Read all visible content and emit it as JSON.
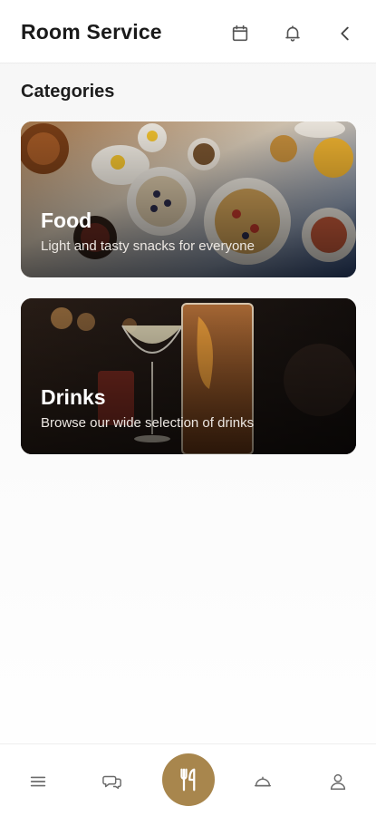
{
  "header": {
    "title": "Room Service",
    "icons": [
      "calendar-icon",
      "bell-icon",
      "back-chevron-icon"
    ]
  },
  "section": {
    "title": "Categories"
  },
  "categories": [
    {
      "title": "Food",
      "subtitle": "Light and tasty snacks for everyone"
    },
    {
      "title": "Drinks",
      "subtitle": "Browse our wide selection of drinks"
    }
  ],
  "bottom_nav": {
    "items": [
      "menu-icon",
      "chat-icon",
      "cutlery-icon",
      "service-bell-icon",
      "user-icon"
    ],
    "active": "cutlery-icon"
  },
  "colors": {
    "accent": "#a8864d",
    "icon": "#5b5b5b",
    "text": "#1a1a1a"
  }
}
